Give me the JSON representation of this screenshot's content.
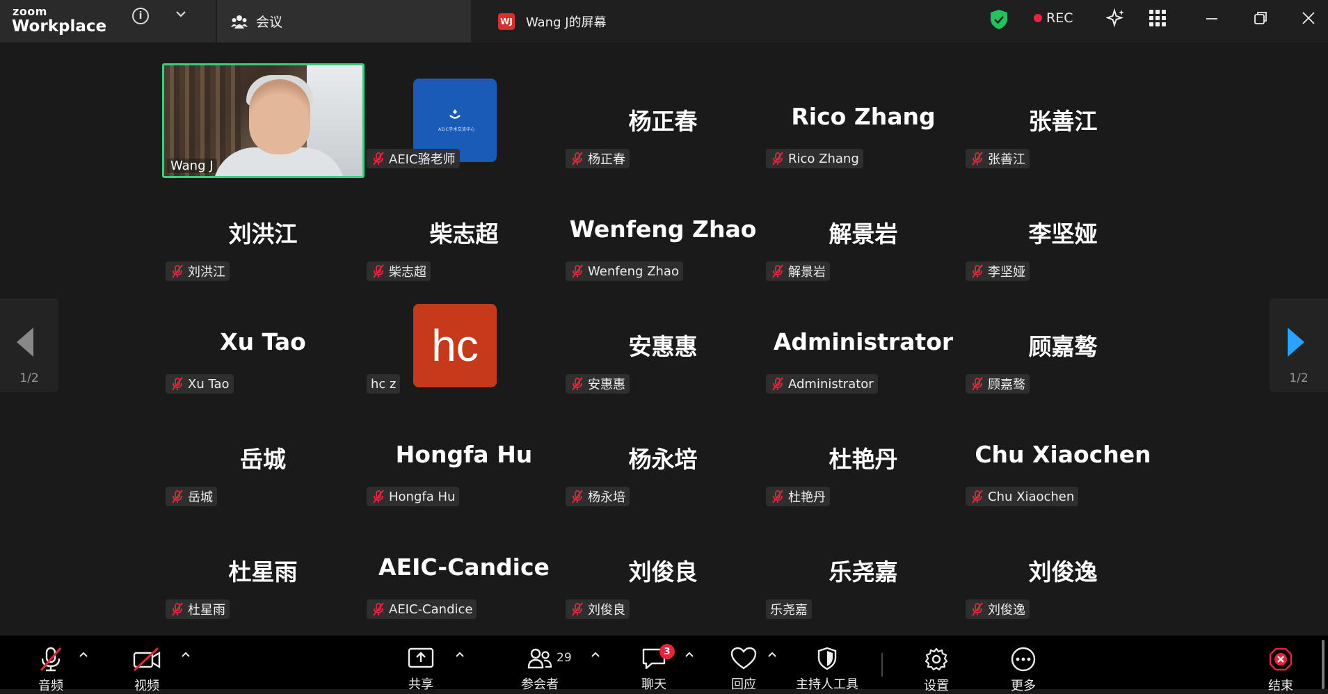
{
  "titlebar": {
    "brand_small": "zoom",
    "brand_large": "Workplace",
    "meeting_tab_label": "会议",
    "share_tab_badge": "WJ",
    "share_tab_label": "Wang J的屏幕",
    "rec_label": "REC",
    "colors": {
      "secure_shield": "#22c35e",
      "rec_dot": "#e8243c"
    }
  },
  "gallery": {
    "page_indicator_left": "1/2",
    "page_indicator_right": "1/2",
    "active_speaker_color": "#34d17a",
    "video_tile": {
      "name": "Wang J"
    },
    "avatar_tiles": {
      "aeic": {
        "logo_text": "AEIC学术交流中心",
        "bg_color": "#1a5bb8"
      },
      "hc": {
        "initials": "hc",
        "bg_color": "#c63a1b"
      }
    },
    "tiles": [
      {
        "center": "",
        "plate": "AEIC骆老师",
        "muted": true
      },
      {
        "center": "杨正春",
        "plate": "杨正春",
        "muted": true
      },
      {
        "center": "Rico Zhang",
        "plate": "Rico Zhang",
        "muted": true
      },
      {
        "center": "张善江",
        "plate": "张善江",
        "muted": true
      },
      {
        "center": "刘洪江",
        "plate": "刘洪江",
        "muted": true
      },
      {
        "center": "柴志超",
        "plate": "柴志超",
        "muted": true
      },
      {
        "center": "Wenfeng Zhao",
        "plate": "Wenfeng Zhao",
        "muted": true
      },
      {
        "center": "解景岩",
        "plate": "解景岩",
        "muted": true
      },
      {
        "center": "李坚娅",
        "plate": "李坚娅",
        "muted": true
      },
      {
        "center": "Xu Tao",
        "plate": "Xu Tao",
        "muted": true
      },
      {
        "center": "",
        "plate": "hc z",
        "muted": false
      },
      {
        "center": "安惠惠",
        "plate": "安惠惠",
        "muted": true
      },
      {
        "center": "Administrator",
        "plate": "Administrator",
        "muted": true
      },
      {
        "center": "顾嘉骜",
        "plate": "顾嘉骜",
        "muted": true
      },
      {
        "center": "岳城",
        "plate": "岳城",
        "muted": true
      },
      {
        "center": "Hongfa Hu",
        "plate": "Hongfa Hu",
        "muted": true
      },
      {
        "center": "杨永培",
        "plate": "杨永培",
        "muted": true
      },
      {
        "center": "杜艳丹",
        "plate": "杜艳丹",
        "muted": true
      },
      {
        "center": "Chu Xiaochen",
        "plate": "Chu Xiaochen",
        "muted": true
      },
      {
        "center": "杜星雨",
        "plate": "杜星雨",
        "muted": true
      },
      {
        "center": "AEIC-Candice",
        "plate": "AEIC-Candice",
        "muted": true
      },
      {
        "center": "刘俊良",
        "plate": "刘俊良",
        "muted": true
      },
      {
        "center": "乐尧嘉",
        "plate": "乐尧嘉",
        "muted": false
      },
      {
        "center": "刘俊逸",
        "plate": "刘俊逸",
        "muted": true
      }
    ]
  },
  "toolbar": {
    "audio_label": "音频",
    "video_label": "视频",
    "share_label": "共享",
    "participants_label": "参会者",
    "participants_count": "29",
    "chat_label": "聊天",
    "chat_badge": "3",
    "reactions_label": "回应",
    "host_tools_label": "主持人工具",
    "settings_label": "设置",
    "more_label": "更多",
    "end_label": "结束",
    "colors": {
      "muted_red": "#e8243c"
    }
  }
}
